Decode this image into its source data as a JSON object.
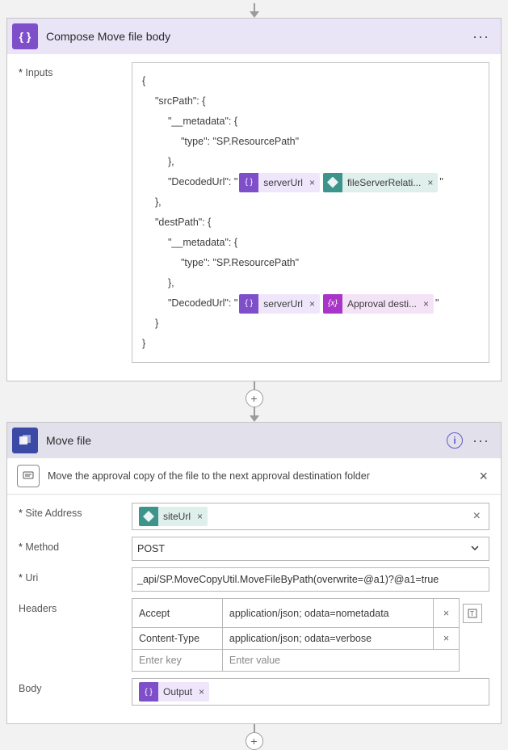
{
  "arrow": {},
  "compose_card": {
    "title": "Compose Move file body",
    "inputs_label": "Inputs",
    "json": {
      "l1": "{",
      "l2": "\"srcPath\": {",
      "l3": "\"__metadata\": {",
      "l4": "\"type\": \"SP.ResourcePath\"",
      "l5": "},",
      "l6a": "\"DecodedUrl\": \"",
      "l6b": "\"",
      "l7": "},",
      "l8": "\"destPath\": {",
      "l9": "\"__metadata\": {",
      "l10": "\"type\": \"SP.ResourcePath\"",
      "l11": "},",
      "l12a": "\"DecodedUrl\": \"",
      "l12b": "\"",
      "l13": "}",
      "l14": "}"
    },
    "tokens": {
      "serverUrl1": "serverUrl",
      "fileServerRelative": "fileServerRelati...",
      "serverUrl2": "serverUrl",
      "approvalDest": "Approval desti..."
    },
    "asterisk": "*"
  },
  "move_card": {
    "title": "Move file",
    "description": "Move the approval copy of the file to the next approval destination folder",
    "labels": {
      "siteAddress": "Site Address",
      "method": "Method",
      "uri": "Uri",
      "headers": "Headers",
      "body": "Body",
      "asterisk": "*"
    },
    "values": {
      "siteUrl": "siteUrl",
      "method": "POST",
      "uri": "_api/SP.MoveCopyUtil.MoveFileByPath(overwrite=@a1)?@a1=true",
      "headers": [
        {
          "key": "Accept",
          "value": "application/json; odata=nometadata"
        },
        {
          "key": "Content-Type",
          "value": "application/json; odata=verbose"
        }
      ],
      "enterKey": "Enter key",
      "enterValue": "Enter value",
      "bodyToken": "Output"
    },
    "close_x": "×",
    "del_x": "×"
  }
}
